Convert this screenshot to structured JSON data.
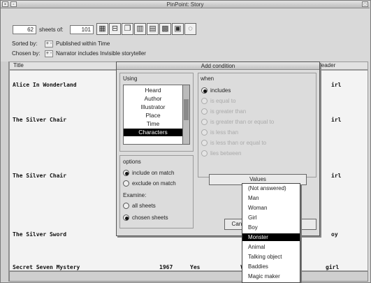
{
  "window": {
    "title": "PinPoint: Story"
  },
  "toolbar": {
    "sheets_count": "62",
    "sheets_of_label": "sheets of:",
    "sheets_total": "101",
    "sorted_by_label": "Sorted by:",
    "sorted_by_value": "Published within Time",
    "chosen_by_label": "Chosen by:",
    "chosen_by_value": "Narrator includes Invisible storyteller",
    "plus_minus": "+ -"
  },
  "table": {
    "col_title": "Title",
    "col_header": "leader",
    "rows": [
      {
        "title": "Alice In Wonderland",
        "c1": "",
        "c2": "",
        "c3": "",
        "end": "irl"
      },
      {
        "title": "The Silver Chair",
        "c1": "",
        "c2": "",
        "c3": "",
        "end": "irl"
      },
      {
        "title": "The Silver Chair",
        "c1": "",
        "c2": "",
        "c3": "",
        "end": "irl"
      },
      {
        "title": "The Silver Sword",
        "c1": "",
        "c2": "",
        "c3": "",
        "end": "oy"
      },
      {
        "title": "Secret Seven Mystery",
        "c1": "1967",
        "c2": "Yes",
        "c3": "Vi",
        "end": "girl"
      }
    ]
  },
  "dialog": {
    "title": "Add condition",
    "using_label": "Using",
    "using_items": [
      "Heard",
      "Author",
      "Illustrator",
      "Place",
      "Time",
      "Characters"
    ],
    "when_label": "when",
    "when_options": [
      "includes",
      "is equal to",
      "is greater than",
      "is greater than or equal to",
      "is less than",
      "is less than or equal to",
      "lies between"
    ],
    "options_label": "options",
    "options": [
      "include on match",
      "exclude on match"
    ],
    "examine_label": "Examine:",
    "examine_options": [
      "all sheets",
      "chosen sheets"
    ],
    "values_label": "Values",
    "cancel_label": "Cancel"
  },
  "values_popup": {
    "items": [
      "(Not answered)",
      "Man",
      "Woman",
      "Girl",
      "Boy",
      "Monster",
      "Animal",
      "Talking object",
      "Baddies",
      "Magic maker"
    ],
    "selected": "Monster"
  }
}
